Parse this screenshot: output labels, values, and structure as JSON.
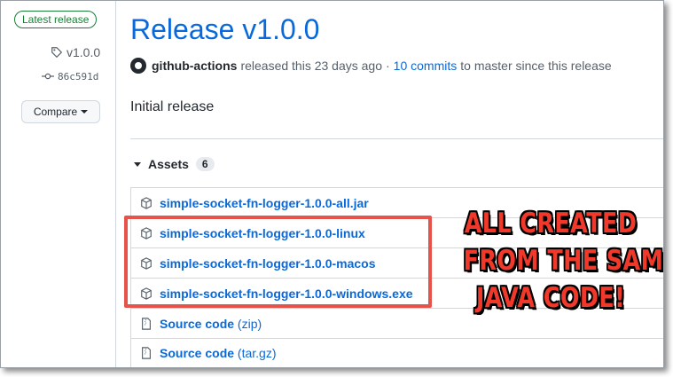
{
  "sidebar": {
    "latest_badge": "Latest release",
    "tag": "v1.0.0",
    "commit": "86c591d",
    "compare_label": "Compare"
  },
  "release": {
    "title": "Release v1.0.0",
    "author": "github-actions",
    "released_text": "released this 23 days ago",
    "separator": "·",
    "commits_link": "10 commits",
    "commits_suffix": "to master since this release",
    "body": "Initial release"
  },
  "assets": {
    "label": "Assets",
    "count": "6",
    "items": [
      {
        "name": "simple-socket-fn-logger-1.0.0-all.jar"
      },
      {
        "name": "simple-socket-fn-logger-1.0.0-linux"
      },
      {
        "name": "simple-socket-fn-logger-1.0.0-macos"
      },
      {
        "name": "simple-socket-fn-logger-1.0.0-windows.exe"
      },
      {
        "name": "Source code",
        "suffix": "(zip)"
      },
      {
        "name": "Source code",
        "suffix": "(tar.gz)"
      }
    ]
  },
  "callout": {
    "line1": "ALL CREATED",
    "line2": "FROM THE SAME",
    "line3": "JAVA CODE!"
  },
  "colors": {
    "link": "#0969da",
    "badge_green": "#1a7f37",
    "highlight_red": "#e5534b",
    "callout_red": "#f0392b"
  }
}
